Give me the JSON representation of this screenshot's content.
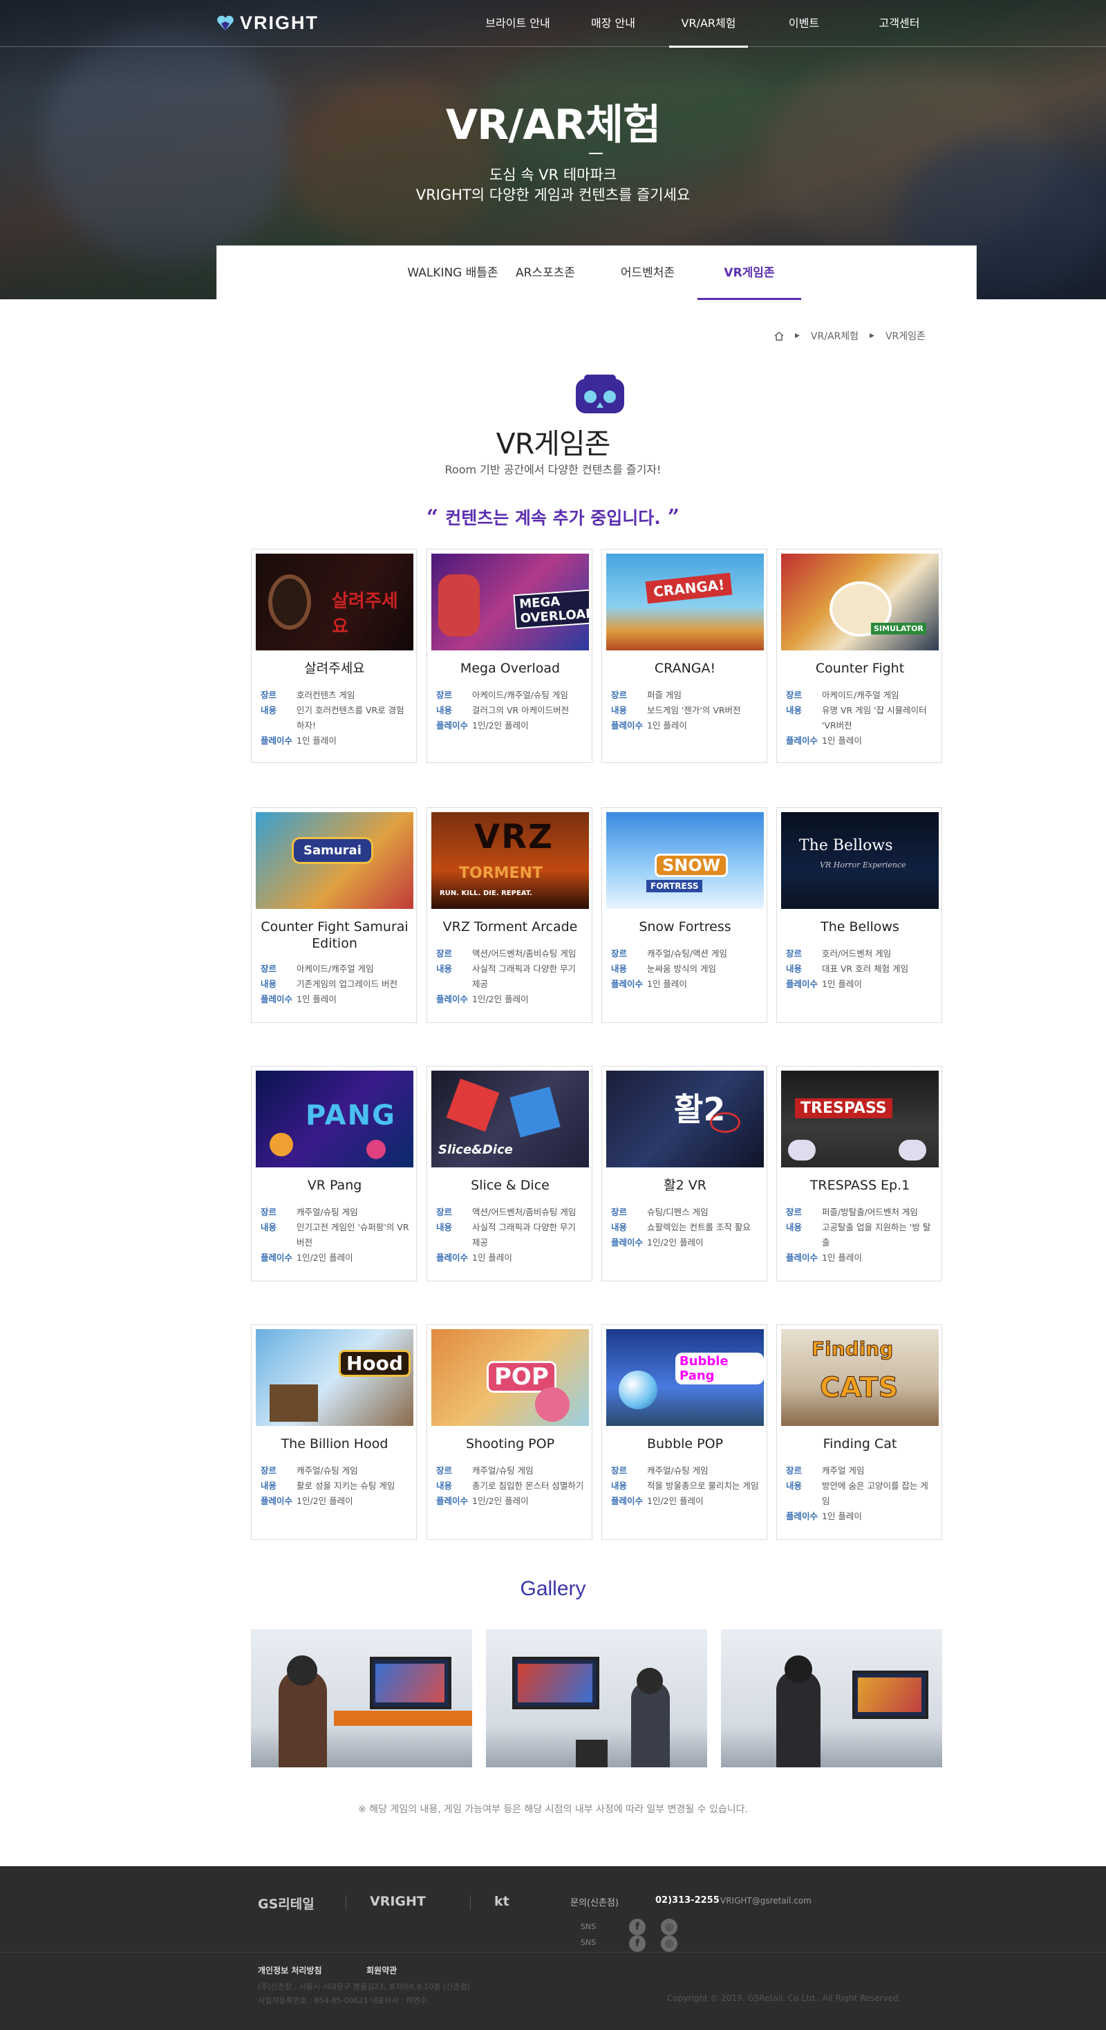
{
  "header": {
    "logo": "VRIGHT",
    "nav": [
      "브라이트 안내",
      "매장 안내",
      "VR/AR체험",
      "이벤트",
      "고객센터"
    ],
    "active": "VR/AR체험"
  },
  "hero": {
    "title": "VR/AR체험",
    "sub1": "도심 속 VR 테마파크",
    "sub2": "VRIGHT의 다양한 게임과 컨텐츠를 즐기세요"
  },
  "tabs": [
    "WALKING 배틀존",
    "AR스포츠존",
    "어드벤처존",
    "VR게임존"
  ],
  "breadcrumb": [
    "VR/AR체험",
    "VR게임존"
  ],
  "zone": {
    "title": "VR게임존",
    "subtitle": "Room 기반 공간에서 다양한 컨텐츠를 즐기자!",
    "quote": "컨텐츠는 계속 추가 중입니다."
  },
  "labels": {
    "genre": "장르",
    "content": "내용",
    "players": "플레이수"
  },
  "games": [
    {
      "title": "살려주세요",
      "genre": "호러컨텐츠 게임",
      "content": "인기 호러컨텐츠를 VR로 경험하자!",
      "players": "1인 플레이"
    },
    {
      "title": "Mega Overload",
      "genre": "아케이드/캐주얼/슈팅 게임",
      "content": "걸러그의 VR 아케이드버전",
      "players": "1인/2인 플레이"
    },
    {
      "title": "CRANGA!",
      "genre": "퍼즐 게임",
      "content": "보드게임 '젠가'의 VR버전",
      "players": "1인 플레이"
    },
    {
      "title": "Counter Fight",
      "genre": "아케이드/캐주얼 게임",
      "content": "유명 VR 게임 '잡 시뮬레이터 'VR버전",
      "players": "1인 플레이"
    },
    {
      "title": "Counter Fight Samurai Edition",
      "genre": "아케이드/캐주얼 게임",
      "content": "기존게임의 업그레이드 버전",
      "players": "1인 플레이"
    },
    {
      "title": "VRZ Torment Arcade",
      "genre": "액션/어드벤처/좀비슈팅 게임",
      "content": "사실적 그래픽과 다양한 무기 제공",
      "players": "1인/2인 플레이"
    },
    {
      "title": "Snow Fortress",
      "genre": "캐주얼/슈팅/액션 게임",
      "content": "눈싸움 방식의 게임",
      "players": "1인 플레이"
    },
    {
      "title": "The Bellows",
      "genre": "호러/어드벤처 게임",
      "content": "대표 VR 호러 체험 게임",
      "players": "1인 플레이"
    },
    {
      "title": "VR Pang",
      "genre": "캐주얼/슈팅 게임",
      "content": "인기고전 게임인 '슈퍼팡'의 VR 버전",
      "players": "1인/2인 플레이"
    },
    {
      "title": "Slice & Dice",
      "genre": "액션/어드벤처/좀비슈팅 게임",
      "content": "사실적 그래픽과 다양한 무기 제공",
      "players": "1인 플레이"
    },
    {
      "title": "활2 VR",
      "genre": "슈팅/디펜스 게임",
      "content": "쇼팔렉있는 컨트롤 조작 활요",
      "players": "1인/2인 플레이"
    },
    {
      "title": "TRESPASS Ep.1",
      "genre": "퍼즐/방탈출/어드벤처 게임",
      "content": "고공탈출 업을 지원하는 '방 탈출",
      "players": "1인 플레이"
    },
    {
      "title": "The Billion Hood",
      "genre": "캐주얼/슈팅 게임",
      "content": "활로 성을 지키는 슈팅 게임",
      "players": "1인/2인 플레이"
    },
    {
      "title": "Shooting POP",
      "genre": "캐주얼/슈팅 게임",
      "content": "총기로 침입한 몬스터 섬멸하기",
      "players": "1인/2인 플레이"
    },
    {
      "title": "Bubble POP",
      "genre": "캐주얼/슈팅 게임",
      "content": "적을 방울총으로 물리치는 게임",
      "players": "1인/2인 플레이"
    },
    {
      "title": "Finding Cat",
      "genre": "캐주얼 게임",
      "content": "방안에 숨은 고양이를 잡는 게임",
      "players": "1인 플레이"
    }
  ],
  "thumb_text": {
    "t0": "살려주세요",
    "t1": "MEGA OVERLOAD",
    "t2": "CRANGA!",
    "t3": "SIMULATOR",
    "t4": "Samurai",
    "t5a": "VRZ",
    "t5b": "TORMENT",
    "t5c": "RUN. KILL. DIE. REPEAT.",
    "t6a": "SNOW",
    "t6b": "FORTRESS",
    "t7a": "The Bellows",
    "t7b": "VR Horror Experience",
    "t8": "PANG",
    "t9": "Slice&Dice",
    "t10": "활2",
    "t11": "TRESPASS",
    "t12": "Hood",
    "t13": "POP",
    "t14": "Bubble Pang",
    "t15a": "Finding",
    "t15b": "CATS"
  },
  "gallery": {
    "title": "Gallery"
  },
  "note": "※ 해당 게임의 내용, 게임 가능여부 등은 해당 시점의 내부 사정에 따라 일부 변경될 수 있습니다.",
  "footer": {
    "logos": [
      "GS리테일",
      "VRIGHT",
      "kt"
    ],
    "inquiry_label": "문의(신촌점)",
    "phone": "02)313-2255",
    "email": "VRIGHT@gsretail.com",
    "sns": "SNS",
    "privacy": "개인정보 처리방침",
    "terms": "회원약관",
    "address": "(주)신촌점 : 서울시 서대문구 명물길23, 포지아8,9,10층 (신촌점)",
    "bizno": "사업자등록번호 : 854-85-00621  대표이사 : 허연수",
    "copyright": "Copyright © 2019. GSRetail. Co Ltd.. All Right Reserved."
  },
  "colors": {
    "accent": "#5b2fb0",
    "label_blue": "#3a6fb5",
    "footer_bg": "#2d2d2d"
  }
}
